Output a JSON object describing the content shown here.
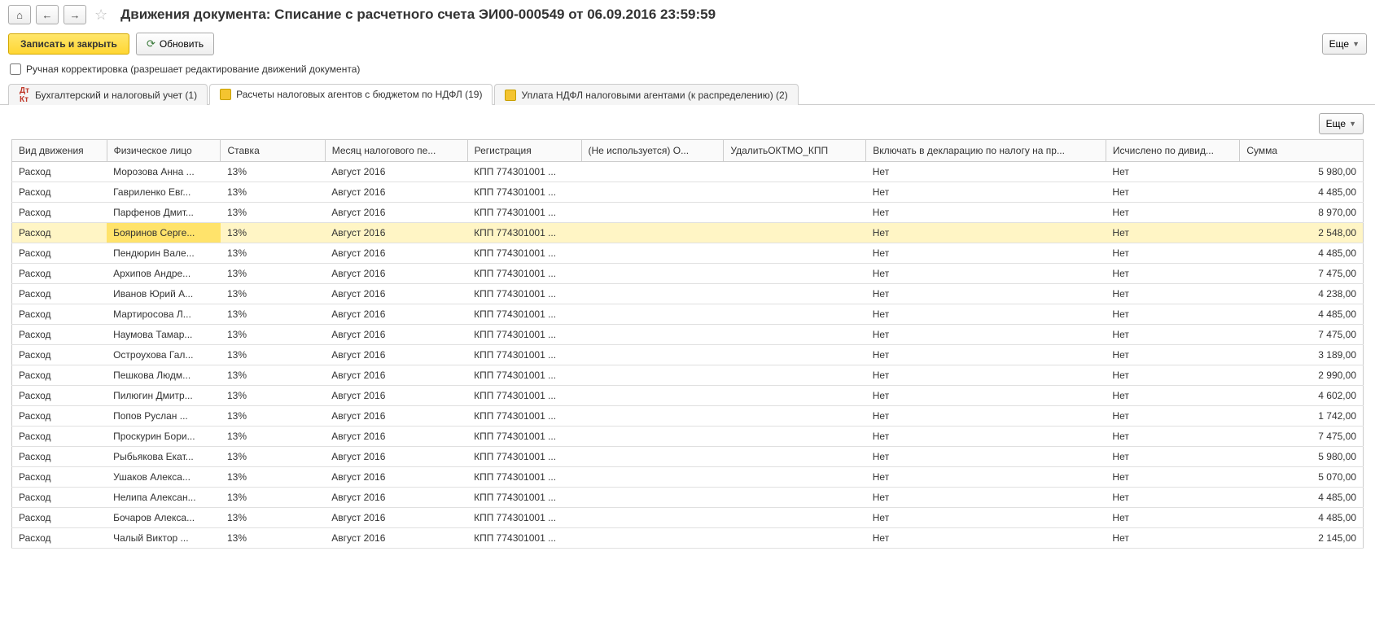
{
  "header": {
    "title": "Движения документа: Списание с расчетного счета ЭИ00-000549 от 06.09.2016 23:59:59"
  },
  "toolbar": {
    "save_close": "Записать и закрыть",
    "refresh": "Обновить",
    "more": "Еще"
  },
  "checkbox": {
    "label": "Ручная корректировка (разрешает редактирование движений документа)"
  },
  "tabs": [
    {
      "label": "Бухгалтерский и налоговый учет (1)"
    },
    {
      "label": "Расчеты налоговых агентов с бюджетом по НДФЛ (19)"
    },
    {
      "label": "Уплата НДФЛ налоговыми агентами (к распределению) (2)"
    }
  ],
  "table": {
    "more": "Еще",
    "headers": {
      "move": "Вид движения",
      "person": "Физическое лицо",
      "rate": "Ставка",
      "month": "Месяц налогового пе...",
      "reg": "Регистрация",
      "unused": "(Не используется) О...",
      "oktmo": "УдалитьОКТМО_КПП",
      "decl": "Включать в декларацию по налогу на пр...",
      "divid": "Исчислено по дивид...",
      "sum": "Сумма"
    },
    "rows": [
      {
        "move": "Расход",
        "person": "Морозова Анна ...",
        "rate": "13%",
        "month": "Август 2016",
        "reg": "КПП 774301001 ...",
        "unused": "",
        "oktmo": "",
        "decl": "Нет",
        "divid": "Нет",
        "sum": "5 980,00",
        "hl": false
      },
      {
        "move": "Расход",
        "person": "Гавриленко Евг...",
        "rate": "13%",
        "month": "Август 2016",
        "reg": "КПП 774301001 ...",
        "unused": "",
        "oktmo": "",
        "decl": "Нет",
        "divid": "Нет",
        "sum": "4 485,00",
        "hl": false
      },
      {
        "move": "Расход",
        "person": "Парфенов Дмит...",
        "rate": "13%",
        "month": "Август 2016",
        "reg": "КПП 774301001 ...",
        "unused": "",
        "oktmo": "",
        "decl": "Нет",
        "divid": "Нет",
        "sum": "8 970,00",
        "hl": false
      },
      {
        "move": "Расход",
        "person": "Бояринов Серге...",
        "rate": "13%",
        "month": "Август 2016",
        "reg": "КПП 774301001 ...",
        "unused": "",
        "oktmo": "",
        "decl": "Нет",
        "divid": "Нет",
        "sum": "2 548,00",
        "hl": true
      },
      {
        "move": "Расход",
        "person": "Пендюрин Вале...",
        "rate": "13%",
        "month": "Август 2016",
        "reg": "КПП 774301001 ...",
        "unused": "",
        "oktmo": "",
        "decl": "Нет",
        "divid": "Нет",
        "sum": "4 485,00",
        "hl": false
      },
      {
        "move": "Расход",
        "person": "Архипов Андре...",
        "rate": "13%",
        "month": "Август 2016",
        "reg": "КПП 774301001 ...",
        "unused": "",
        "oktmo": "",
        "decl": "Нет",
        "divid": "Нет",
        "sum": "7 475,00",
        "hl": false
      },
      {
        "move": "Расход",
        "person": "Иванов Юрий А...",
        "rate": "13%",
        "month": "Август 2016",
        "reg": "КПП 774301001 ...",
        "unused": "",
        "oktmo": "",
        "decl": "Нет",
        "divid": "Нет",
        "sum": "4 238,00",
        "hl": false
      },
      {
        "move": "Расход",
        "person": "Мартиросова Л...",
        "rate": "13%",
        "month": "Август 2016",
        "reg": "КПП 774301001 ...",
        "unused": "",
        "oktmo": "",
        "decl": "Нет",
        "divid": "Нет",
        "sum": "4 485,00",
        "hl": false
      },
      {
        "move": "Расход",
        "person": "Наумова Тамар...",
        "rate": "13%",
        "month": "Август 2016",
        "reg": "КПП 774301001 ...",
        "unused": "",
        "oktmo": "",
        "decl": "Нет",
        "divid": "Нет",
        "sum": "7 475,00",
        "hl": false
      },
      {
        "move": "Расход",
        "person": "Остроухова Гал...",
        "rate": "13%",
        "month": "Август 2016",
        "reg": "КПП 774301001 ...",
        "unused": "",
        "oktmo": "",
        "decl": "Нет",
        "divid": "Нет",
        "sum": "3 189,00",
        "hl": false
      },
      {
        "move": "Расход",
        "person": "Пешкова Людм...",
        "rate": "13%",
        "month": "Август 2016",
        "reg": "КПП 774301001 ...",
        "unused": "",
        "oktmo": "",
        "decl": "Нет",
        "divid": "Нет",
        "sum": "2 990,00",
        "hl": false
      },
      {
        "move": "Расход",
        "person": "Пилюгин Дмитр...",
        "rate": "13%",
        "month": "Август 2016",
        "reg": "КПП 774301001 ...",
        "unused": "",
        "oktmo": "",
        "decl": "Нет",
        "divid": "Нет",
        "sum": "4 602,00",
        "hl": false
      },
      {
        "move": "Расход",
        "person": "Попов Руслан ...",
        "rate": "13%",
        "month": "Август 2016",
        "reg": "КПП 774301001 ...",
        "unused": "",
        "oktmo": "",
        "decl": "Нет",
        "divid": "Нет",
        "sum": "1 742,00",
        "hl": false
      },
      {
        "move": "Расход",
        "person": "Проскурин Бори...",
        "rate": "13%",
        "month": "Август 2016",
        "reg": "КПП 774301001 ...",
        "unused": "",
        "oktmo": "",
        "decl": "Нет",
        "divid": "Нет",
        "sum": "7 475,00",
        "hl": false
      },
      {
        "move": "Расход",
        "person": "Рыбьякова Екат...",
        "rate": "13%",
        "month": "Август 2016",
        "reg": "КПП 774301001 ...",
        "unused": "",
        "oktmo": "",
        "decl": "Нет",
        "divid": "Нет",
        "sum": "5 980,00",
        "hl": false
      },
      {
        "move": "Расход",
        "person": "Ушаков Алекса...",
        "rate": "13%",
        "month": "Август 2016",
        "reg": "КПП 774301001 ...",
        "unused": "",
        "oktmo": "",
        "decl": "Нет",
        "divid": "Нет",
        "sum": "5 070,00",
        "hl": false
      },
      {
        "move": "Расход",
        "person": "Нелипа Алексан...",
        "rate": "13%",
        "month": "Август 2016",
        "reg": "КПП 774301001 ...",
        "unused": "",
        "oktmo": "",
        "decl": "Нет",
        "divid": "Нет",
        "sum": "4 485,00",
        "hl": false
      },
      {
        "move": "Расход",
        "person": "Бочаров Алекса...",
        "rate": "13%",
        "month": "Август 2016",
        "reg": "КПП 774301001 ...",
        "unused": "",
        "oktmo": "",
        "decl": "Нет",
        "divid": "Нет",
        "sum": "4 485,00",
        "hl": false
      },
      {
        "move": "Расход",
        "person": "Чалый Виктор ...",
        "rate": "13%",
        "month": "Август 2016",
        "reg": "КПП 774301001 ...",
        "unused": "",
        "oktmo": "",
        "decl": "Нет",
        "divid": "Нет",
        "sum": "2 145,00",
        "hl": false
      }
    ]
  }
}
